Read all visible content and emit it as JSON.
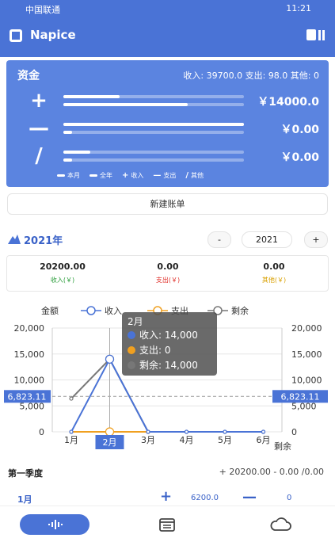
{
  "status_bar": {
    "carrier": "中国联通",
    "time": "11:21"
  },
  "app_bar": {
    "title": "Napice",
    "logo_icon": "app-logo-icon",
    "menu_icon": "account-menu-icon"
  },
  "fund": {
    "title": "资金",
    "summary": "收入: 39700.0  支出: 98.0  其他: 0",
    "rows": [
      {
        "symbol": "+",
        "value": "￥14000.0",
        "month_fill": 0.31,
        "year_fill": 0.69
      },
      {
        "symbol": "—",
        "value": "￥0.00",
        "month_fill": 1.0,
        "year_fill": 0.05
      },
      {
        "symbol": "/",
        "value": "￥0.00",
        "month_fill": 0.15,
        "year_fill": 0.05
      }
    ],
    "legend": [
      {
        "mark": "dash",
        "label": "本月"
      },
      {
        "mark": "dash",
        "label": "全年"
      },
      {
        "mark": "+",
        "label": "收入"
      },
      {
        "mark": "—",
        "label": "支出"
      },
      {
        "mark": "/",
        "label": "其他"
      }
    ]
  },
  "new_bill_label": "新建账单",
  "year": {
    "label": "2021年",
    "minus_label": "-",
    "value": "2021",
    "plus_label": "+"
  },
  "totals": [
    {
      "value": "20200.00",
      "label": "收入(￥)",
      "color": "#2a9d3a"
    },
    {
      "value": "0.00",
      "label": "支出(￥)",
      "color": "#e0302a"
    },
    {
      "value": "0.00",
      "label": "其他(￥)",
      "color": "#d9a000"
    }
  ],
  "chart_data": {
    "type": "line",
    "categories": [
      "1月",
      "2月",
      "3月",
      "4月",
      "5月",
      "6月"
    ],
    "selected_category": "2月",
    "series": [
      {
        "name": "收入",
        "values": [
          0,
          14000,
          0,
          0,
          0,
          0
        ],
        "color": "#4a73d6"
      },
      {
        "name": "支出",
        "values": [
          0,
          0,
          0,
          0,
          0,
          0
        ],
        "color": "#f0a020"
      },
      {
        "name": "剩余",
        "values": [
          6400,
          14000,
          0,
          0,
          0,
          0
        ],
        "color": "#777777"
      }
    ],
    "ylabel": "金额",
    "xlabel_extra": "剩余",
    "ylim": [
      0,
      20000
    ],
    "yticks": [
      "0",
      "5,000",
      "10,000",
      "15,000",
      "20,000"
    ],
    "average_line": {
      "value": 6823.11,
      "label": "6,823.11"
    },
    "tooltip": {
      "title": "2月",
      "rows": [
        {
          "label": "收入: 14,000",
          "color": "#4a73d6"
        },
        {
          "label": "支出: 0",
          "color": "#f0a020"
        },
        {
          "label": "剩余: 14,000",
          "color": "#777777"
        }
      ]
    }
  },
  "section": {
    "title": "第一季度",
    "summary": "+ 20200.00  - 0.00  /0.00"
  },
  "month_row": {
    "name": "1月",
    "plus": "+",
    "income": "6200.0",
    "minus": "—",
    "expense": "0"
  },
  "bottom_nav": [
    {
      "icon": "waveform-icon"
    },
    {
      "icon": "calendar-icon"
    },
    {
      "icon": "cloud-icon"
    }
  ]
}
